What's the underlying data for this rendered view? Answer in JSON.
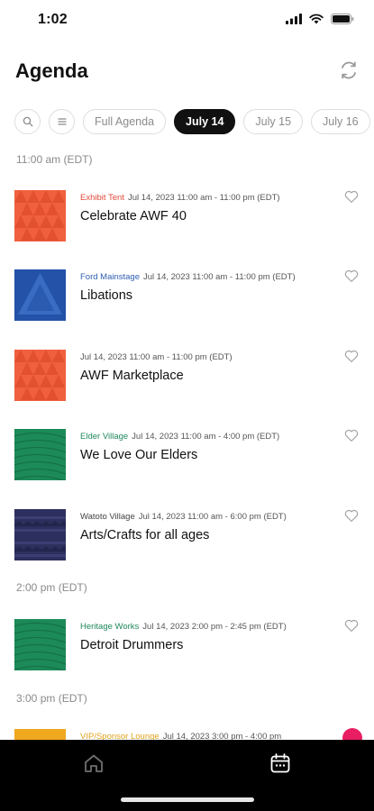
{
  "status": {
    "time": "1:02"
  },
  "header": {
    "title": "Agenda"
  },
  "chips": [
    {
      "label": "Full Agenda"
    },
    {
      "label": "July 14"
    },
    {
      "label": "July 15"
    },
    {
      "label": "July 16"
    }
  ],
  "time_sections": [
    "11:00 am (EDT)",
    "2:00 pm (EDT)",
    "3:00 pm (EDT)"
  ],
  "events": [
    {
      "venue": "Exhibit Tent",
      "venue_color": "#e24a3a",
      "datetime": "Jul 14, 2023 11:00 am - 11:00 pm (EDT)",
      "title": "Celebrate AWF 40",
      "thumb": "orange-triangles"
    },
    {
      "venue": "Ford Mainstage",
      "venue_color": "#2f5fb3",
      "datetime": "Jul 14, 2023 11:00 am - 11:00 pm (EDT)",
      "title": "Libations",
      "thumb": "blue-triangle"
    },
    {
      "venue": "",
      "venue_color": "#555555",
      "datetime": "Jul 14, 2023 11:00 am - 11:00 pm (EDT)",
      "title": "AWF Marketplace",
      "thumb": "orange-triangles"
    },
    {
      "venue": "Elder Village",
      "venue_color": "#1f8a5c",
      "datetime": "Jul 14, 2023 11:00 am -  4:00 pm (EDT)",
      "title": "We Love Our Elders",
      "thumb": "green-stripes"
    },
    {
      "venue": "Watoto Village",
      "venue_color": "#444444",
      "datetime": "Jul 14, 2023 11:00 am -  6:00 pm (EDT)",
      "title": "Arts/Crafts for all ages",
      "thumb": "navy-pattern"
    },
    {
      "venue": "Heritage Works",
      "venue_color": "#1f8a5c",
      "datetime": "Jul 14, 2023  2:00 pm -  2:45 pm (EDT)",
      "title": "Detroit Drummers",
      "thumb": "green-stripes"
    },
    {
      "venue": "VIP/Sponsor Lounge",
      "venue_color": "#e0a21c",
      "datetime": "Jul 14, 2023  3:00 pm -  4:00 pm",
      "title": "",
      "thumb": "yellow"
    }
  ],
  "icons": {
    "status": [
      "signal-icon",
      "wifi-icon",
      "battery-icon"
    ],
    "header": "refresh-icon",
    "chips": [
      "search-icon",
      "filter-icon"
    ],
    "tabs": [
      "home-icon",
      "calendar-icon"
    ]
  }
}
